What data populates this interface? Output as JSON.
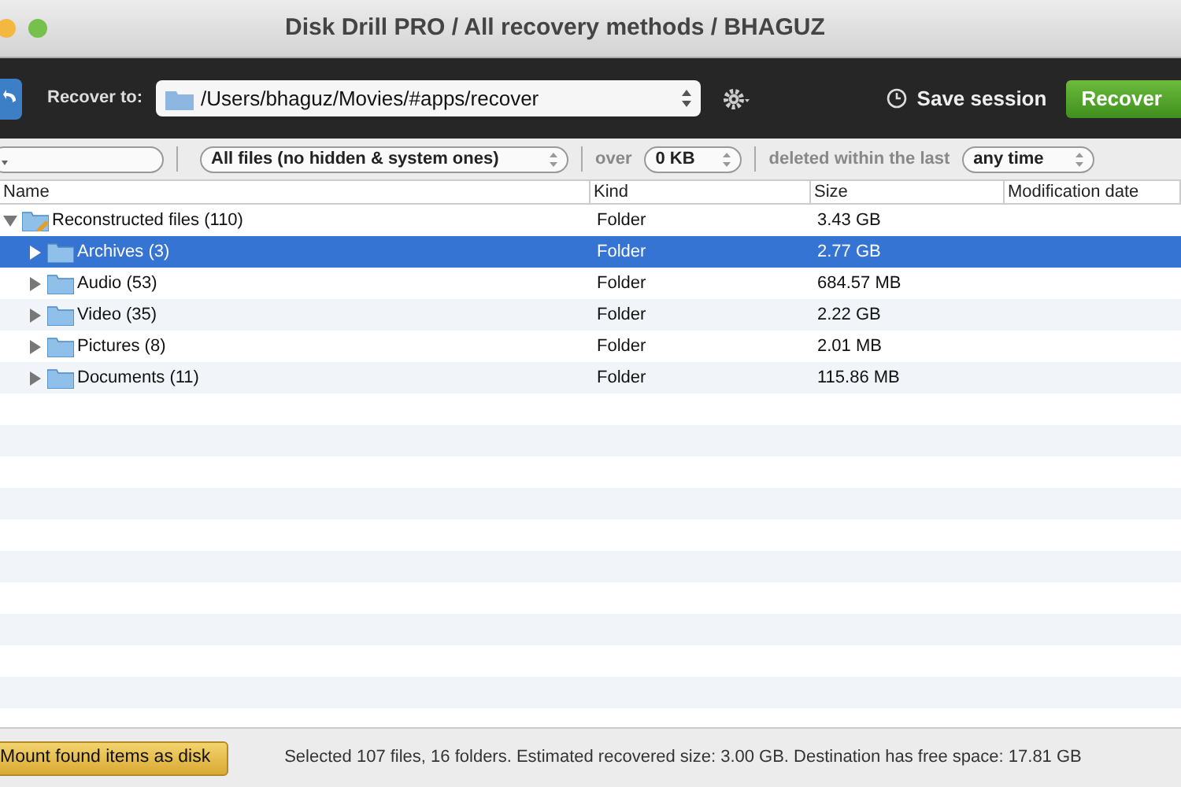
{
  "window": {
    "title": "Disk Drill PRO / All recovery methods / BHAGUZ"
  },
  "toolbar": {
    "recover_to_label": "Recover to:",
    "path": "/Users/bhaguz/Movies/#apps/recover",
    "save_session": "Save session",
    "recover_button": "Recover"
  },
  "filters": {
    "file_type": "All files (no hidden & system ones)",
    "over_label": "over",
    "size": "0 KB",
    "deleted_label": "deleted within the last",
    "time": "any time"
  },
  "table": {
    "columns": [
      "Name",
      "Kind",
      "Size",
      "Modification date"
    ],
    "rows": [
      {
        "name": "Reconstructed files (110)",
        "kind": "Folder",
        "size": "3.43 GB",
        "expanded": true,
        "selected": false,
        "children": [
          {
            "name": "Archives (3)",
            "kind": "Folder",
            "size": "2.77 GB",
            "expanded": false,
            "selected": true
          },
          {
            "name": "Audio (53)",
            "kind": "Folder",
            "size": "684.57 MB",
            "expanded": false,
            "selected": false
          },
          {
            "name": "Video (35)",
            "kind": "Folder",
            "size": "2.22 GB",
            "expanded": false,
            "selected": false
          },
          {
            "name": "Pictures (8)",
            "kind": "Folder",
            "size": "2.01 MB",
            "expanded": false,
            "selected": false
          },
          {
            "name": "Documents (11)",
            "kind": "Folder",
            "size": "115.86 MB",
            "expanded": false,
            "selected": false
          }
        ]
      }
    ]
  },
  "status_bar": {
    "mount_button": "Mount found items as disk",
    "text": "Selected 107 files, 16 folders. Estimated recovered size: 3.00 GB. Destination has free space: 17.81 GB"
  }
}
